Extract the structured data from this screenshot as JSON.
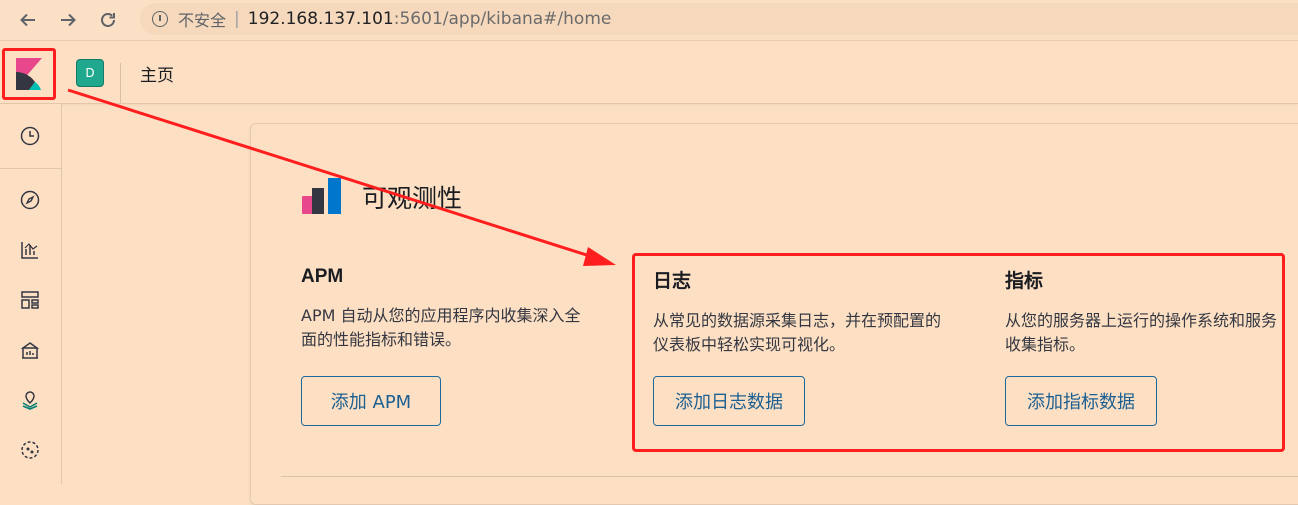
{
  "browser": {
    "security_label": "不安全",
    "url_host": "192.168.137.101",
    "url_rest": ":5601/app/kibana#/home"
  },
  "header": {
    "space_initial": "D",
    "breadcrumb": "主页"
  },
  "sidenav": {
    "icons": [
      "recently-viewed-icon",
      "discover-icon",
      "visualize-icon",
      "dashboard-icon",
      "canvas-icon",
      "maps-icon",
      "ml-icon"
    ]
  },
  "observability": {
    "title": "可观测性",
    "columns": [
      {
        "title": "APM",
        "description": "APM 自动从您的应用程序内收集深入全面的性能指标和错误。",
        "button": "添加 APM"
      },
      {
        "title": "日志",
        "description": "从常见的数据源采集日志，并在预配置的仪表板中轻松实现可视化。",
        "button": "添加日志数据"
      },
      {
        "title": "指标",
        "description": "从您的服务器上运行的操作系统和服务收集指标。",
        "button": "添加指标数据"
      }
    ]
  },
  "colors": {
    "background": "#fde0c4",
    "annotation_red": "#ff1e1e",
    "button_blue": "#1c5f91",
    "space_badge": "#20a88e"
  }
}
